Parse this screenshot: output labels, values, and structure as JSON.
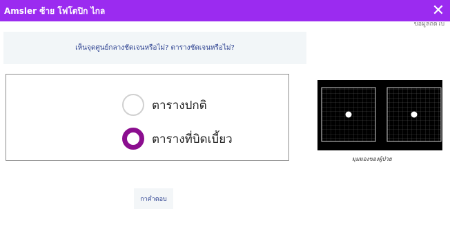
{
  "window": {
    "title": "Amsler ซ้าย โฟโตปิก ไกล",
    "close_icon": "close-icon",
    "behind_text": "ข้อมูลถัดไป"
  },
  "question": "เห็นจุดศูนย์กลางชัดเจนหรือไม่? ตารางชัดเจนหรือไม่?",
  "options": {
    "normal_label": "ตารางปกติ",
    "distorted_label": "ตารางที่บิดเบี้ยว",
    "selected": "distorted"
  },
  "figure": {
    "caption": "มุมมองของผู้ป่วย"
  },
  "submit_label": "กาคำตอบ",
  "colors": {
    "titlebar": "#9b2bf0",
    "radio_selected": "#8b0e8f",
    "link_text": "#2a3f8f"
  }
}
